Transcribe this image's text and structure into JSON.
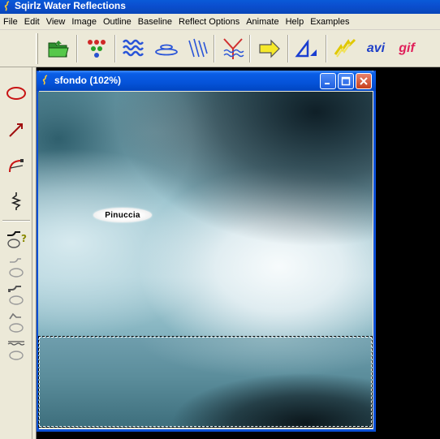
{
  "app": {
    "title": "Sqirlz Water Reflections"
  },
  "menu": [
    "File",
    "Edit",
    "View",
    "Image",
    "Outline",
    "Baseline",
    "Reflect Options",
    "Animate",
    "Help",
    "Examples"
  ],
  "toolbar": {
    "avi_label": "avi",
    "gif_label": "gif"
  },
  "document": {
    "title": "sfondo  (102%)",
    "label_text": "Pinuccia"
  },
  "colors": {
    "titlebar": "#0b4fd0",
    "close_button": "#c7401c",
    "canvas_teal": "#5e97a7"
  }
}
